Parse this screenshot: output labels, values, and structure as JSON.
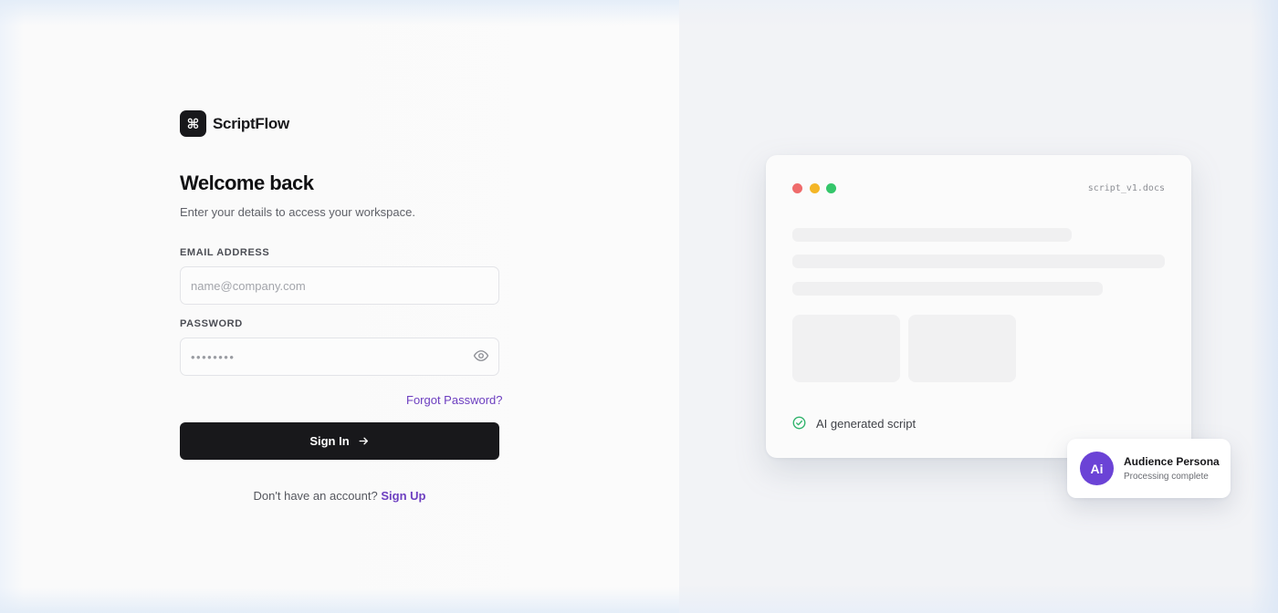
{
  "brand": {
    "name": "ScriptFlow",
    "logo_glyph": "⌘",
    "logo_color": "#18181b"
  },
  "login": {
    "title": "Welcome back",
    "subtitle": "Enter your details to access your workspace.",
    "email_label": "EMAIL ADDRESS",
    "email_placeholder": "name@company.com",
    "email_value": "",
    "password_label": "PASSWORD",
    "password_placeholder": "••••••••",
    "password_value": "",
    "password_toggle_icon": "eye-icon",
    "forgot_label": "Forgot Password?",
    "signin_label": "Sign In",
    "signin_icon": "arrow-right-icon",
    "no_account_text": "Don't have an account?",
    "signup_label": "Sign Up",
    "accent_color": "#6d3fc0"
  },
  "preview": {
    "filename": "script_v1.docs",
    "window_dots": [
      "#ef6b6b",
      "#f4b626",
      "#34c66a"
    ],
    "status_icon": "check-circle-icon",
    "status_text": "AI generated script",
    "status_color": "#2fb36b"
  },
  "persona": {
    "avatar_text": "Ai",
    "avatar_color": "#6b43d6",
    "title": "Audience Persona",
    "subtitle": "Processing complete"
  }
}
